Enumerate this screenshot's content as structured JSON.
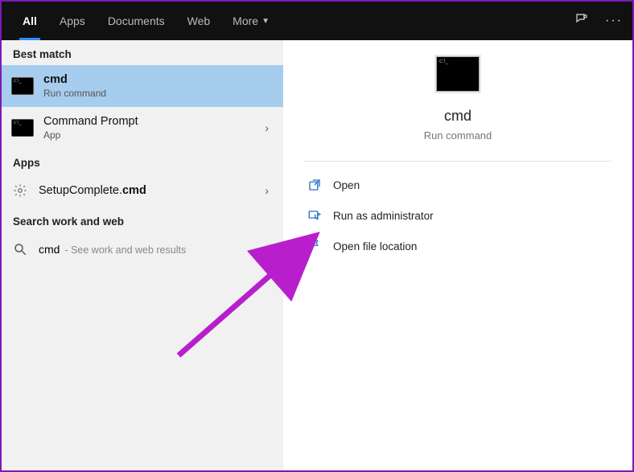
{
  "tabs": {
    "all": "All",
    "apps": "Apps",
    "documents": "Documents",
    "web": "Web",
    "more": "More"
  },
  "left": {
    "bestMatchLabel": "Best match",
    "appsLabel": "Apps",
    "searchWorkWebLabel": "Search work and web",
    "results": {
      "cmd": {
        "title": "cmd",
        "sub": "Run command"
      },
      "commandPrompt": {
        "title": "Command Prompt",
        "sub": "App"
      },
      "setupComplete": {
        "prefix": "SetupComplete.",
        "bold": "cmd"
      },
      "web": {
        "query": "cmd",
        "hint": "- See work and web results"
      }
    }
  },
  "preview": {
    "title": "cmd",
    "sub": "Run command"
  },
  "actions": {
    "open": "Open",
    "runAdmin": "Run as administrator",
    "openLocation": "Open file location"
  }
}
